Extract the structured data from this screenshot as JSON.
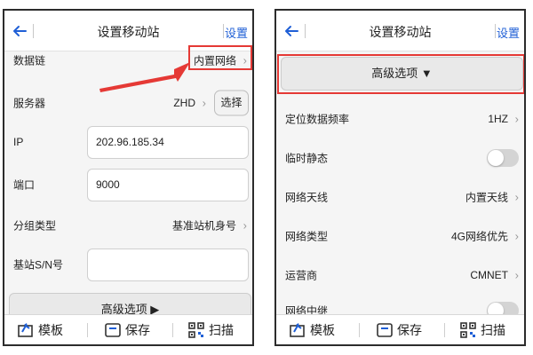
{
  "left": {
    "header": {
      "title": "设置移动站",
      "set_label": "设置"
    },
    "rows": {
      "data_link": {
        "label": "数据链",
        "value": "内置网络"
      },
      "server": {
        "label": "服务器",
        "value": "ZHD",
        "button": "选择"
      },
      "ip": {
        "label": "IP",
        "value": "202.96.185.34"
      },
      "port": {
        "label": "端口",
        "value": "9000"
      },
      "group_type": {
        "label": "分组类型",
        "value": "基准站机身号"
      },
      "base_sn": {
        "label": "基站S/N号",
        "value": ""
      }
    },
    "advanced": {
      "label": "高级选项 ▶"
    }
  },
  "right": {
    "header": {
      "title": "设置移动站",
      "set_label": "设置"
    },
    "advanced": {
      "label": "高级选项 ▼"
    },
    "rows": {
      "freq": {
        "label": "定位数据频率",
        "value": "1HZ"
      },
      "temp_static": {
        "label": "临时静态"
      },
      "antenna": {
        "label": "网络天线",
        "value": "内置天线"
      },
      "net_type": {
        "label": "网络类型",
        "value": "4G网络优先"
      },
      "operator": {
        "label": "运营商",
        "value": "CMNET"
      },
      "relay": {
        "label": "网络中继"
      }
    }
  },
  "toolbar": {
    "template": "模板",
    "save": "保存",
    "scan": "扫描"
  },
  "icons": [
    "back-arrow-icon",
    "template-icon",
    "save-icon",
    "qr-scan-icon",
    "chevron-right-icon"
  ],
  "colors": {
    "accent": "#1f5fd6",
    "highlight": "#e53935",
    "toggle_off": "#d4d4d4"
  }
}
